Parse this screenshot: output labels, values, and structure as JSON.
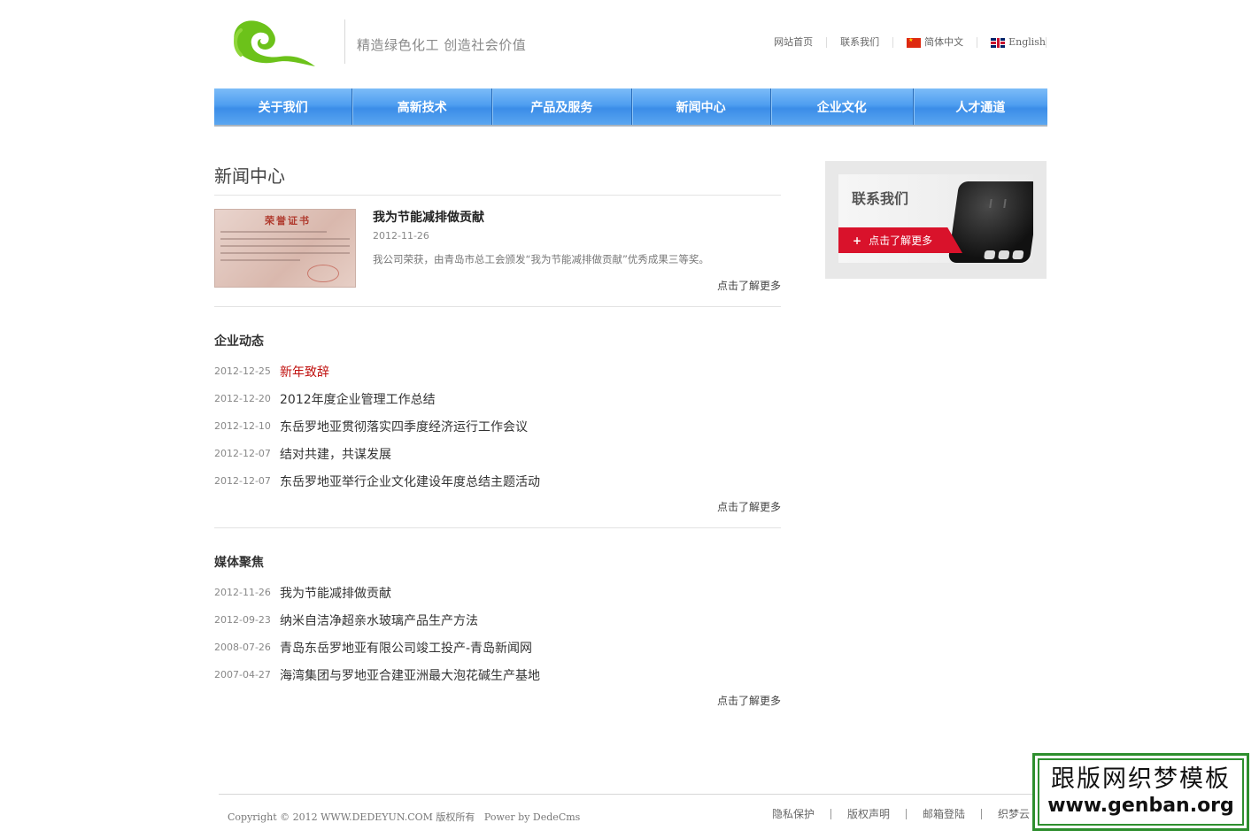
{
  "header": {
    "slogan": "精造绿色化工 创造社会价值",
    "top_links": [
      {
        "label": "网站首页",
        "icon": ""
      },
      {
        "label": "联系我们",
        "icon": ""
      },
      {
        "label": "简体中文",
        "icon": "flag-cn-icon"
      },
      {
        "label": "English",
        "icon": "flag-uk-icon"
      }
    ]
  },
  "nav": {
    "items": [
      "关于我们",
      "高新技术",
      "产品及服务",
      "新闻中心",
      "企业文化",
      "人才通道"
    ]
  },
  "main": {
    "section_title": "新闻中心",
    "featured": {
      "image_title": "荣誉证书",
      "title": "我为节能减排做贡献",
      "date": "2012-11-26",
      "description": "我公司荣获，由青岛市总工会颁发“我为节能减排做贡献”优秀成果三等奖。",
      "more": "点击了解更多"
    },
    "company_news": {
      "title": "企业动态",
      "items": [
        {
          "date": "2012-12-25",
          "title": "新年致辞"
        },
        {
          "date": "2012-12-20",
          "title": "2012年度企业管理工作总结"
        },
        {
          "date": "2012-12-10",
          "title": "东岳罗地亚贯彻落实四季度经济运行工作会议"
        },
        {
          "date": "2012-12-07",
          "title": "结对共建，共谋发展"
        },
        {
          "date": "2012-12-07",
          "title": "东岳罗地亚举行企业文化建设年度总结主题活动"
        }
      ],
      "more": "点击了解更多"
    },
    "media_focus": {
      "title": "媒体聚焦",
      "items": [
        {
          "date": "2012-11-26",
          "title": "我为节能减排做贡献"
        },
        {
          "date": "2012-09-23",
          "title": "纳米自洁净超亲水玻璃产品生产方法"
        },
        {
          "date": "2008-07-26",
          "title": "青岛东岳罗地亚有限公司竣工投产-青岛新闻网"
        },
        {
          "date": "2007-04-27",
          "title": "海湾集团与罗地亚合建亚洲最大泡花碱生产基地"
        }
      ],
      "more": "点击了解更多"
    }
  },
  "sidebar": {
    "contact_title": "联系我们",
    "contact_button": "点击了解更多"
  },
  "footer": {
    "copyright": "Copyright © 2012 WWW.DEDEYUN.COM 版权所有   Power by DedeCms",
    "links": [
      "隐私保护",
      "版权声明",
      "邮箱登陆",
      "织梦云"
    ]
  },
  "watermark": {
    "line1": "跟版网织梦模板",
    "line2": "www.genban.org"
  },
  "colors": {
    "nav_blue": "#4f9ef0",
    "logo_green": "#6cc21a",
    "hot_red": "#c0100e",
    "button_red": "#d9122b",
    "watermark_green": "#2e8f2e"
  }
}
